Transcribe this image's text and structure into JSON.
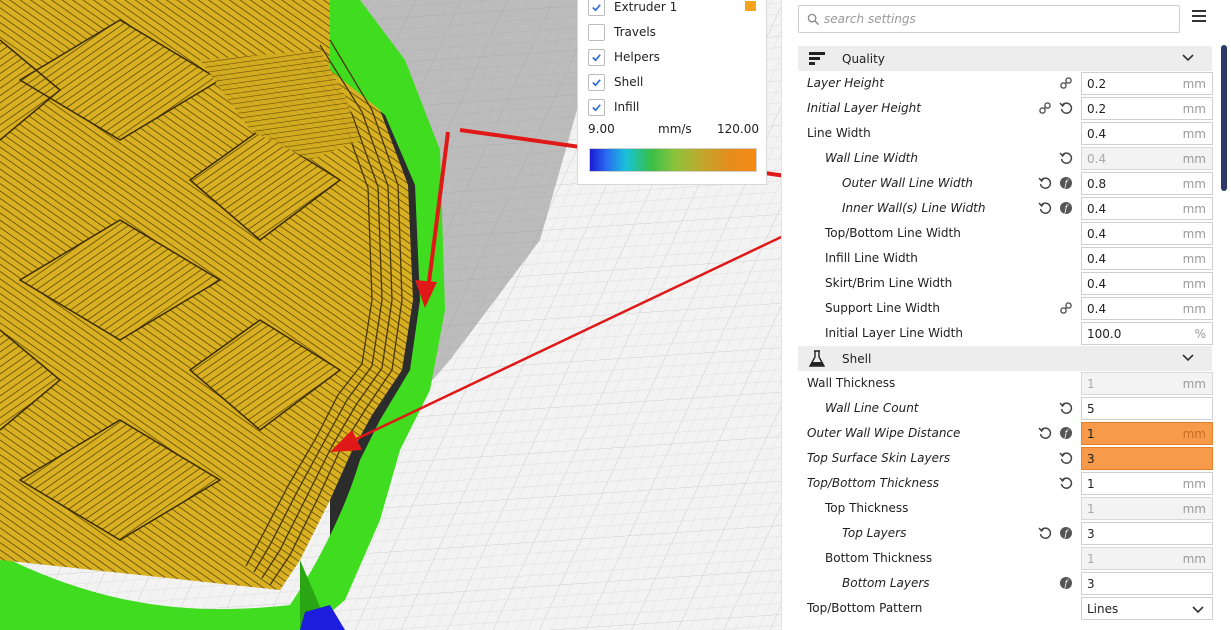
{
  "legend": {
    "items": [
      {
        "label": "Extruder 1",
        "checked": true
      },
      {
        "label": "Travels",
        "checked": false
      },
      {
        "label": "Helpers",
        "checked": true
      },
      {
        "label": "Shell",
        "checked": true
      },
      {
        "label": "Infill",
        "checked": true
      }
    ],
    "scale_min": "9.00",
    "scale_unit": "mm/s",
    "scale_max": "120.00",
    "extruder_color": "#f5a21b"
  },
  "search": {
    "placeholder": "search settings"
  },
  "categories": {
    "quality": {
      "label": "Quality",
      "icon": "quality-icon"
    },
    "shell": {
      "label": "Shell",
      "icon": "flask-icon"
    }
  },
  "settings": [
    {
      "label": "Layer Height",
      "value": "0.2",
      "unit": "mm",
      "italic": true,
      "indent": 0,
      "icons": [
        "link"
      ]
    },
    {
      "label": "Initial Layer Height",
      "value": "0.2",
      "unit": "mm",
      "italic": true,
      "indent": 0,
      "icons": [
        "link",
        "reset"
      ]
    },
    {
      "label": "Line Width",
      "value": "0.4",
      "unit": "mm",
      "italic": false,
      "indent": 0,
      "icons": []
    },
    {
      "label": "Wall Line Width",
      "value": "0.4",
      "unit": "mm",
      "italic": true,
      "indent": 1,
      "icons": [
        "reset"
      ],
      "state": "disabled"
    },
    {
      "label": "Outer Wall Line Width",
      "value": "0.8",
      "unit": "mm",
      "italic": true,
      "indent": 2,
      "icons": [
        "reset",
        "function"
      ]
    },
    {
      "label": "Inner Wall(s) Line Width",
      "value": "0.4",
      "unit": "mm",
      "italic": true,
      "indent": 2,
      "icons": [
        "reset",
        "function"
      ]
    },
    {
      "label": "Top/Bottom Line Width",
      "value": "0.4",
      "unit": "mm",
      "italic": false,
      "indent": 1,
      "icons": []
    },
    {
      "label": "Infill Line Width",
      "value": "0.4",
      "unit": "mm",
      "italic": false,
      "indent": 1,
      "icons": []
    },
    {
      "label": "Skirt/Brim Line Width",
      "value": "0.4",
      "unit": "mm",
      "italic": false,
      "indent": 1,
      "icons": []
    },
    {
      "label": "Support Line Width",
      "value": "0.4",
      "unit": "mm",
      "italic": false,
      "indent": 1,
      "icons": [
        "link"
      ]
    },
    {
      "label": "Initial Layer Line Width",
      "value": "100.0",
      "unit": "%",
      "italic": false,
      "indent": 1,
      "icons": []
    },
    {
      "label": "Wall Thickness",
      "value": "1",
      "unit": "mm",
      "italic": false,
      "indent": 0,
      "icons": [],
      "state": "disabled"
    },
    {
      "label": "Wall Line Count",
      "value": "5",
      "unit": "",
      "italic": true,
      "indent": 1,
      "icons": [
        "reset"
      ]
    },
    {
      "label": "Outer Wall Wipe Distance",
      "value": "1",
      "unit": "mm",
      "italic": true,
      "indent": 0,
      "icons": [
        "reset",
        "function"
      ],
      "state": "error"
    },
    {
      "label": "Top Surface Skin Layers",
      "value": "3",
      "unit": "",
      "italic": true,
      "indent": 0,
      "icons": [
        "reset"
      ],
      "state": "error"
    },
    {
      "label": "Top/Bottom Thickness",
      "value": "1",
      "unit": "mm",
      "italic": true,
      "indent": 0,
      "icons": [
        "reset"
      ]
    },
    {
      "label": "Top Thickness",
      "value": "1",
      "unit": "mm",
      "italic": false,
      "indent": 1,
      "icons": [],
      "state": "disabled"
    },
    {
      "label": "Top Layers",
      "value": "3",
      "unit": "",
      "italic": true,
      "indent": 2,
      "icons": [
        "reset",
        "function"
      ]
    },
    {
      "label": "Bottom Thickness",
      "value": "1",
      "unit": "mm",
      "italic": false,
      "indent": 1,
      "icons": [],
      "state": "disabled"
    },
    {
      "label": "Bottom Layers",
      "value": "3",
      "unit": "",
      "italic": true,
      "indent": 2,
      "icons": [
        "function"
      ]
    },
    {
      "label": "Top/Bottom Pattern",
      "value": "Lines",
      "unit": "",
      "italic": false,
      "indent": 0,
      "icons": [],
      "state": "dropdown"
    }
  ],
  "colors": {
    "annotation_arrow": "#e01818",
    "error_field": "#f79a4a",
    "shell_green": "#3ddc1e",
    "infill_yellow": "#d9b21f"
  }
}
